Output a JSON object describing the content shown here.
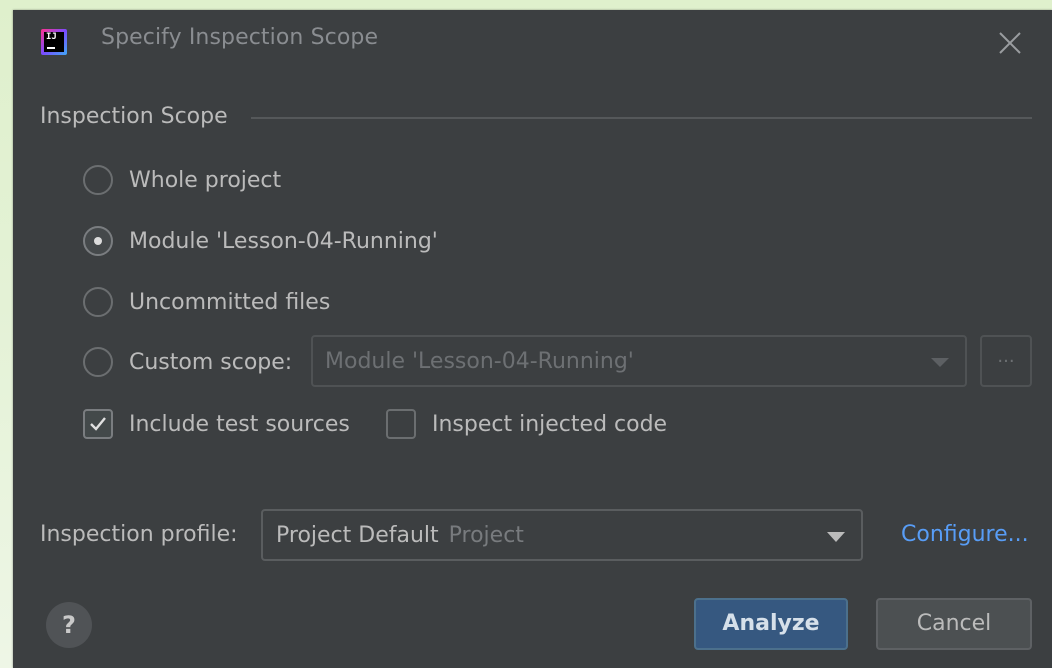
{
  "dialog": {
    "title": "Specify Inspection Scope",
    "app_icon_text": "IJ"
  },
  "scope": {
    "group_label": "Inspection Scope",
    "options": [
      {
        "label": "Whole project",
        "selected": false
      },
      {
        "label": "Module 'Lesson-04-Running'",
        "selected": true
      },
      {
        "label": "Uncommitted files",
        "selected": false
      },
      {
        "label": "Custom scope:",
        "selected": false
      }
    ],
    "custom_scope_value": "Module 'Lesson-04-Running'",
    "ellipsis_label": "..."
  },
  "checks": {
    "include_test_sources": {
      "label": "Include test sources",
      "checked": true
    },
    "inspect_injected_code": {
      "label": "Inspect injected code",
      "checked": false
    }
  },
  "profile": {
    "label": "Inspection profile:",
    "name": "Project Default",
    "sub": "Project",
    "configure_label": "Configure..."
  },
  "buttons": {
    "help_label": "?",
    "analyze_label": "Analyze",
    "cancel_label": "Cancel"
  },
  "colors": {
    "dialog_bg": "#3c3f41",
    "primary_button": "#365880",
    "link": "#589df6",
    "backdrop": "#dff0cc"
  },
  "icons": {
    "app": "intellij-idea-icon",
    "close": "close-icon",
    "dropdown": "chevron-down-icon",
    "check": "checkmark-icon"
  }
}
